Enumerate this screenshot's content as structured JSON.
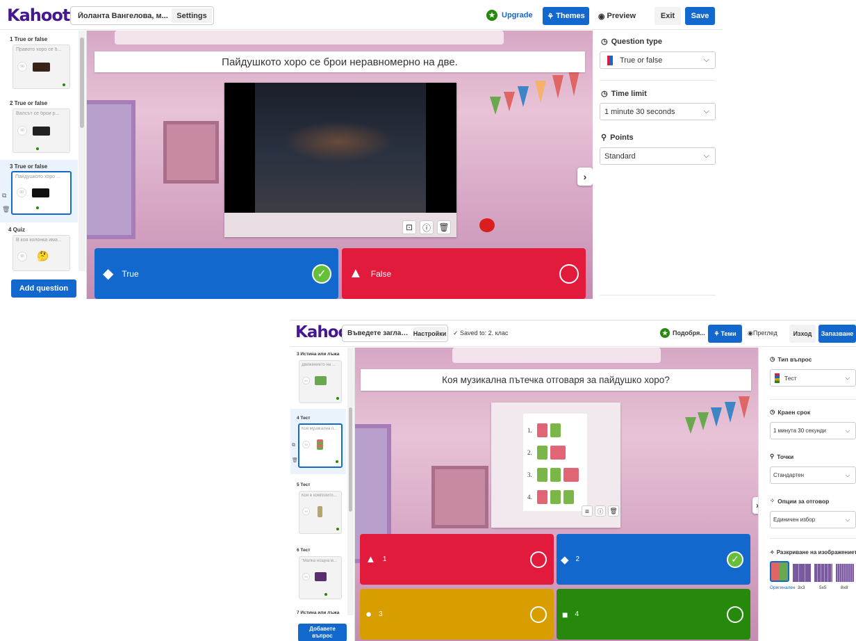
{
  "s1": {
    "logo": "Kahoot!",
    "title": "Йоланта Вангелова, м...",
    "settings": "Settings",
    "upgrade": "Upgrade",
    "themes": "Themes",
    "preview": "Preview",
    "exit": "Exit",
    "save": "Save",
    "slides": [
      {
        "label": "1  True or false",
        "text": "Правото хоро се б..."
      },
      {
        "label": "2  True or false",
        "text": "Валсът се брои р..."
      },
      {
        "label": "3  True or false",
        "text": "Пайдушкото хоро ..."
      },
      {
        "label": "4  Quiz",
        "text": "В коя колонка има..."
      }
    ],
    "thumb_timer": "90",
    "add_question": "Add question",
    "question": "Пайдушкото хоро се брои неравномерно на две.",
    "answers": [
      {
        "text": "True",
        "color": "#1368ce",
        "shape": "diamond",
        "correct": true
      },
      {
        "text": "False",
        "color": "#e21b3c",
        "shape": "triangle",
        "correct": false
      }
    ],
    "panel": {
      "qtype_label": "Question type",
      "qtype_value": "True or false",
      "time_label": "Time limit",
      "time_value": "1 minute 30 seconds",
      "points_label": "Points",
      "points_value": "Standard"
    }
  },
  "s2": {
    "logo": "Kahoot!",
    "title": "Въведете заглавие ...",
    "settings": "Настройки",
    "saved": "Saved to: 2. клас",
    "upgrade": "Подобря...",
    "themes": "Теми",
    "preview": "Преглед",
    "exit": "Изход",
    "save": "Запазване",
    "slides": [
      {
        "label": "3  Истина или лъжа",
        "text": "Движението на ..."
      },
      {
        "label": "4  Тест",
        "text": "Коя музикална п..."
      },
      {
        "label": "5  Тест",
        "text": "Кой е композито..."
      },
      {
        "label": "6  Тест",
        "text": "\"Малка нощна м..."
      },
      {
        "label": "7  Истина или лъжа",
        "text": ""
      }
    ],
    "thumb_timer": "90",
    "add_question": "Добавете въпрос",
    "question": "Коя музикална пътечка  отговаря за пайдушко хоро?",
    "rhythm_rows": [
      {
        "num": "1.",
        "blocks": [
          "red",
          "green"
        ]
      },
      {
        "num": "2.",
        "blocks": [
          "green",
          "red-wide"
        ]
      },
      {
        "num": "3.",
        "blocks": [
          "green",
          "green",
          "red-wide"
        ]
      },
      {
        "num": "4.",
        "blocks": [
          "red",
          "green",
          "green"
        ]
      }
    ],
    "answers": [
      {
        "text": "1",
        "color": "#e21b3c",
        "shape": "triangle",
        "correct": false
      },
      {
        "text": "2",
        "color": "#1368ce",
        "shape": "diamond",
        "correct": true
      },
      {
        "text": "3",
        "color": "#d89e00",
        "shape": "circle",
        "correct": false
      },
      {
        "text": "4",
        "color": "#26890c",
        "shape": "square",
        "correct": false
      }
    ],
    "panel": {
      "qtype_label": "Тип въпрос",
      "qtype_value": "Тест",
      "time_label": "Краен срок",
      "time_value": "1 минута 30 секунди",
      "points_label": "Точки",
      "points_value": "Стандартен",
      "options_label": "Опции за отговор",
      "options_value": "Единичен избор",
      "reveal_label": "Разкриване на изображението",
      "reveal_options": [
        "Оригинален",
        "3x3",
        "5x5",
        "8x8"
      ]
    }
  }
}
